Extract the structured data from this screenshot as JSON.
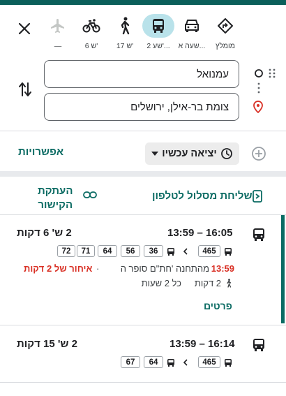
{
  "travel_modes": [
    {
      "id": "recommended",
      "label": "מומלץ",
      "icon": "directions-diamond-icon",
      "active": false
    },
    {
      "id": "driving",
      "label": "שעה א...",
      "icon": "car-icon",
      "active": false
    },
    {
      "id": "transit",
      "label": "2 שע'...",
      "icon": "transit-bus-icon",
      "active": true
    },
    {
      "id": "walking",
      "label": "17 ש'",
      "icon": "walking-icon",
      "active": false
    },
    {
      "id": "cycling",
      "label": "6 ש'",
      "icon": "bicycle-icon",
      "active": false
    },
    {
      "id": "flight",
      "label": "—",
      "icon": "airplane-icon",
      "active": false
    }
  ],
  "route": {
    "origin": "עמנואל",
    "destination": "צומת בר-אילן, ירושלים"
  },
  "options_label": "אפשרויות",
  "depart_label": "יציאה עכשיו",
  "actions": {
    "send_to_phone": "שליחת מסלול לטלפון",
    "copy_link_line1": "העתקת",
    "copy_link_line2": "הקישור"
  },
  "results": [
    {
      "time_range": "13:59 – 16:05",
      "duration": "2 ש' 6 דקות",
      "first_bus": "465",
      "connections": [
        "36",
        "56",
        "64",
        "71",
        "72"
      ],
      "depart_time": "13:59",
      "depart_from": "מהתחנה 'חת\"ם סופר ה",
      "separator": "·",
      "delay": "איחור של 2 דקות",
      "walk": "2 דקות",
      "frequency": "כל 2 שעות",
      "details_label": "פרטים"
    },
    {
      "time_range": "13:59 – 16:14",
      "duration": "2 ש' 15 דקות",
      "first_bus": "465",
      "connections": [
        "64",
        "67"
      ]
    }
  ],
  "colors": {
    "accent": "#0b6b63",
    "active_mode_bg": "#b9e2ea",
    "delay_red": "#d93025",
    "top_bar": "#0b5f5a"
  }
}
